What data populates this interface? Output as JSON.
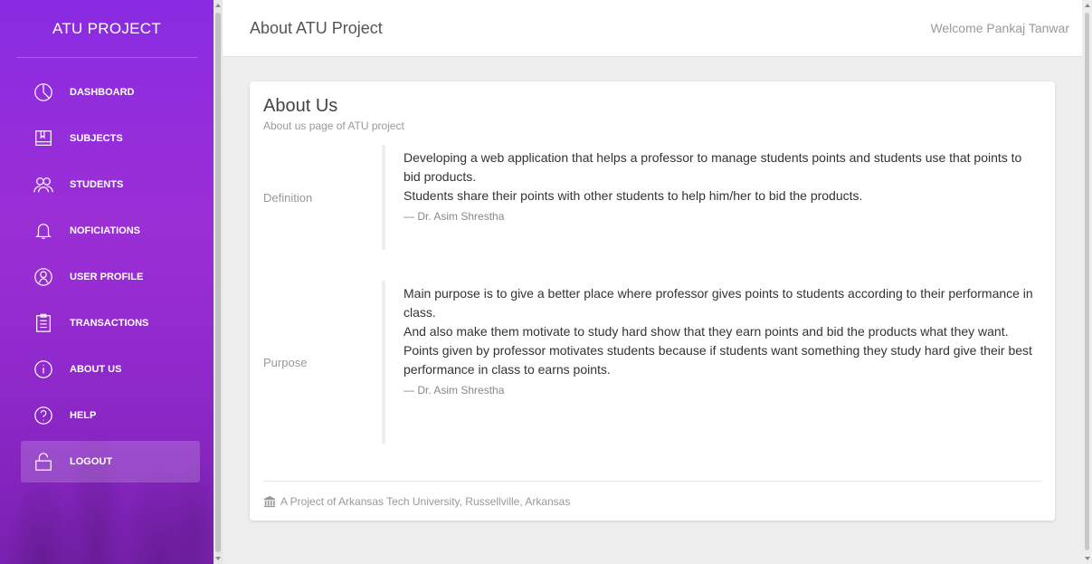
{
  "sidebar": {
    "brand": "ATU PROJECT",
    "items": [
      {
        "label": "DASHBOARD",
        "icon": "pie-chart-icon"
      },
      {
        "label": "SUBJECTS",
        "icon": "book-icon"
      },
      {
        "label": "STUDENTS",
        "icon": "users-icon"
      },
      {
        "label": "NOFICIATIONS",
        "icon": "bell-icon"
      },
      {
        "label": "USER PROFILE",
        "icon": "user-circle-icon"
      },
      {
        "label": "TRANSACTIONS",
        "icon": "clipboard-icon"
      },
      {
        "label": "ABOUT US",
        "icon": "info-icon"
      },
      {
        "label": "HELP",
        "icon": "help-icon"
      },
      {
        "label": "LOGOUT",
        "icon": "lock-icon"
      }
    ],
    "active_item": "LOGOUT"
  },
  "header": {
    "title": "About ATU Project",
    "welcome": "Welcome Pankaj Tanwar"
  },
  "card": {
    "title": "About Us",
    "subtitle": "About us page of ATU project",
    "sections": [
      {
        "label": "Definition",
        "lines": [
          "Developing a web application that helps a professor to manage students points and students use that points to bid products.",
          "Students share their points with other students to help him/her to bid the products."
        ],
        "author": "— Dr. Asim Shrestha"
      },
      {
        "label": "Purpose",
        "lines": [
          "Main purpose is to give a better place where professor gives points to students according to their performance in class.",
          "And also make them motivate to study hard show that they earn points and bid the products what they want.",
          "Points given by professor motivates students because if students want something they study hard give their best performance in class to earns points."
        ],
        "author": "— Dr. Asim Shrestha"
      }
    ],
    "footer": "A Project of Arkansas Tech University, Russellville, Arkansas",
    "footer_icon": "bank-icon"
  },
  "colors": {
    "sidebar_gradient_top": "#8a2be2",
    "sidebar_gradient_bottom": "#7a20b0",
    "background": "#eeeeee"
  }
}
